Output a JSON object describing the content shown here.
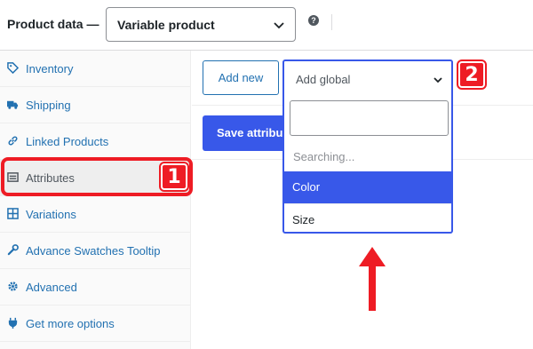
{
  "header": {
    "title": "Product data —",
    "product_type": "Variable product",
    "help_glyph": "?"
  },
  "sidebar": {
    "items": [
      {
        "label": "Inventory",
        "icon": "tag-icon"
      },
      {
        "label": "Shipping",
        "icon": "truck-icon"
      },
      {
        "label": "Linked Products",
        "icon": "link-icon"
      },
      {
        "label": "Attributes",
        "icon": "list-icon",
        "active": true
      },
      {
        "label": "Variations",
        "icon": "grid-icon"
      },
      {
        "label": "Advance Swatches Tooltip",
        "icon": "wrench-icon"
      },
      {
        "label": "Advanced",
        "icon": "gear-icon"
      },
      {
        "label": "Get more options",
        "icon": "plugin-icon"
      }
    ]
  },
  "main": {
    "add_new_label": "Add new",
    "save_label": "Save attributes"
  },
  "dropdown": {
    "selected": "Add global",
    "search_value": "",
    "status": "Searching...",
    "options": [
      "Color",
      "Size"
    ],
    "highlighted": "Color"
  },
  "annotations": {
    "badge1": "1",
    "badge2": "2",
    "color": "#ee1c24"
  },
  "colors": {
    "accent": "#3858e9",
    "link": "#2271b1"
  }
}
